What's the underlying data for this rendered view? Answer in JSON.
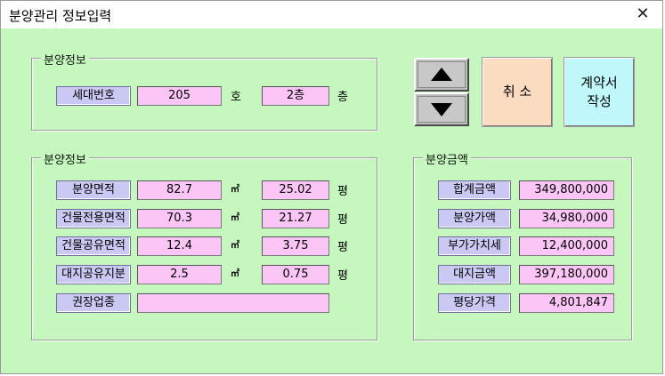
{
  "window": {
    "title": "분양관리 정보입력",
    "close_glyph": "✕"
  },
  "unit_section": {
    "title": "분양정보",
    "label": "세대번호",
    "unit_no": "205",
    "unit_suffix": "호",
    "floor": "2층",
    "floor_suffix": "층"
  },
  "area_section": {
    "title": "분양정보",
    "area_unit": "㎡",
    "pyeong_unit": "평",
    "rows": [
      {
        "label": "분양면적",
        "m2": "82.7",
        "pyeong": "25.02"
      },
      {
        "label": "건물전용면적",
        "m2": "70.3",
        "pyeong": "21.27"
      },
      {
        "label": "건물공유면적",
        "m2": "12.4",
        "pyeong": "3.75"
      },
      {
        "label": "대지공유지분",
        "m2": "2.5",
        "pyeong": "0.75"
      }
    ],
    "business_label": "권장업종",
    "business_value": ""
  },
  "price_section": {
    "title": "분양금액",
    "rows": [
      {
        "label": "합계금액",
        "value": "349,800,000"
      },
      {
        "label": "분양가액",
        "value": "34,980,000"
      },
      {
        "label": "부가가치세",
        "value": "12,400,000"
      },
      {
        "label": "대지금액",
        "value": "397,180,000"
      },
      {
        "label": "평당가격",
        "value": "4,801,847"
      }
    ]
  },
  "buttons": {
    "cancel": "취 소",
    "contract": "계약서\n작성",
    "up_icon": "arrow-up",
    "down_icon": "arrow-down"
  },
  "colors": {
    "background": "#c6f7bf",
    "label_bg": "#c9c9f4",
    "value_bg": "#fbc5f6",
    "cancel_bg": "#fcdcc0",
    "contract_bg": "#bff7fb"
  }
}
